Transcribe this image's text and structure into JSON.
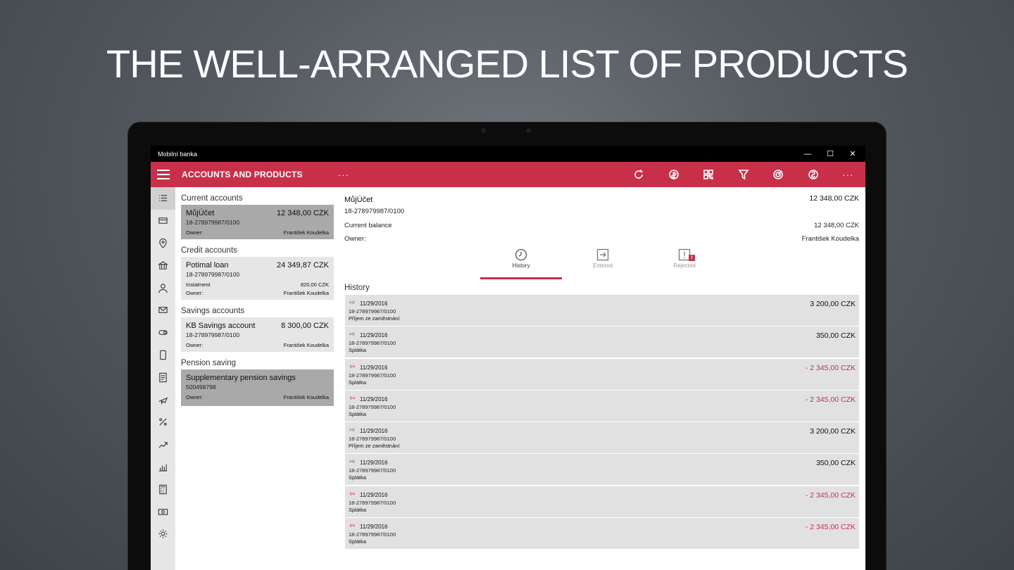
{
  "headline": "THE WELL-ARRANGED LIST OF PRODUCTS",
  "window": {
    "title": "Mobilní banka",
    "minimize": "—",
    "maximize": "☐",
    "close": "✕"
  },
  "appbar": {
    "title": "ACCOUNTS AND PRODUCTS",
    "more": "···",
    "more_right": "···"
  },
  "products": {
    "groups": [
      {
        "title": "Current accounts"
      },
      {
        "title": "Credit accounts"
      },
      {
        "title": "Savings accounts"
      },
      {
        "title": "Pension saving"
      }
    ],
    "cards": [
      {
        "name": "MůjÚčet",
        "amount": "12 348,00 CZK",
        "number": "18-278979987/0100",
        "owner_label": "Owner:",
        "owner": "František Koudelka"
      },
      {
        "name": "Potimal loan",
        "amount": "24 349,87 CZK",
        "number": "18-278979987/0100",
        "instalment_label": "Instalment",
        "instalment": "820,00 CZK",
        "owner_label": "Owner:",
        "owner": "František Koudelka"
      },
      {
        "name": "KB Savings account",
        "amount": "8 300,00 CZK",
        "number": "18-278979987/0100",
        "owner_label": "Owner:",
        "owner": "František Koudelka"
      },
      {
        "name": "Supplementary pension savings",
        "number": "500498798",
        "owner_label": "Owner:",
        "owner": "František Koudelka"
      }
    ]
  },
  "detail": {
    "name": "MůjÚčet",
    "amount": "12 348,00 CZK",
    "number": "18-278979987/0100",
    "balance_label": "Current balance",
    "balance": "12 348,00 CZK",
    "owner_label": "Owner:",
    "owner": "František Koudelka",
    "tabs": [
      "History",
      "Entered",
      "Rejected"
    ],
    "rejected_badge": "!",
    "history_title": "History"
  },
  "transactions": [
    {
      "date": "11/29/2016",
      "account": "18-278979987/0100",
      "desc": "Příjem ze zaměstnání",
      "amount": "3 200,00 CZK",
      "dir": "in"
    },
    {
      "date": "11/29/2016",
      "account": "18-278979987/0100",
      "desc": "Splátka",
      "amount": "350,00 CZK",
      "dir": "in"
    },
    {
      "date": "11/29/2016",
      "account": "18-278979987/0100",
      "desc": "Splátka",
      "amount": "- 2 345,00 CZK",
      "dir": "out"
    },
    {
      "date": "11/29/2016",
      "account": "18-278979987/0100",
      "desc": "Splátka",
      "amount": "- 2 345,00 CZK",
      "dir": "out"
    },
    {
      "date": "11/29/2016",
      "account": "18-278979987/0100",
      "desc": "Příjem ze zaměstnání",
      "amount": "3 200,00 CZK",
      "dir": "in"
    },
    {
      "date": "11/29/2016",
      "account": "18-278979987/0100",
      "desc": "Splátka",
      "amount": "350,00 CZK",
      "dir": "in"
    },
    {
      "date": "11/29/2016",
      "account": "18-278979987/0100",
      "desc": "Splátka",
      "amount": "- 2 345,00 CZK",
      "dir": "out"
    },
    {
      "date": "11/29/2016",
      "account": "18-278979987/0100",
      "desc": "Splátka",
      "amount": "- 2 345,00 CZK",
      "dir": "out"
    }
  ],
  "icons": {
    "appbar": [
      "refresh-icon",
      "coin-transfer-icon",
      "qr-code-icon",
      "filter-icon",
      "target-icon",
      "currency-exchange-icon"
    ],
    "rail": [
      "list-icon",
      "card-icon",
      "location-icon",
      "bank-icon",
      "person-icon",
      "mail-icon",
      "toggle-icon",
      "phone-icon",
      "document-icon",
      "plane-icon",
      "percent-icon",
      "trend-icon",
      "chart-icon",
      "calculator-icon",
      "cash-icon",
      "settings-icon"
    ]
  },
  "colors": {
    "accent": "#c8304a",
    "rail": "#e6e6e6",
    "selected_card": "#a9a9a9",
    "card": "#e6e6e6",
    "tx_row": "#e1e1e1"
  }
}
